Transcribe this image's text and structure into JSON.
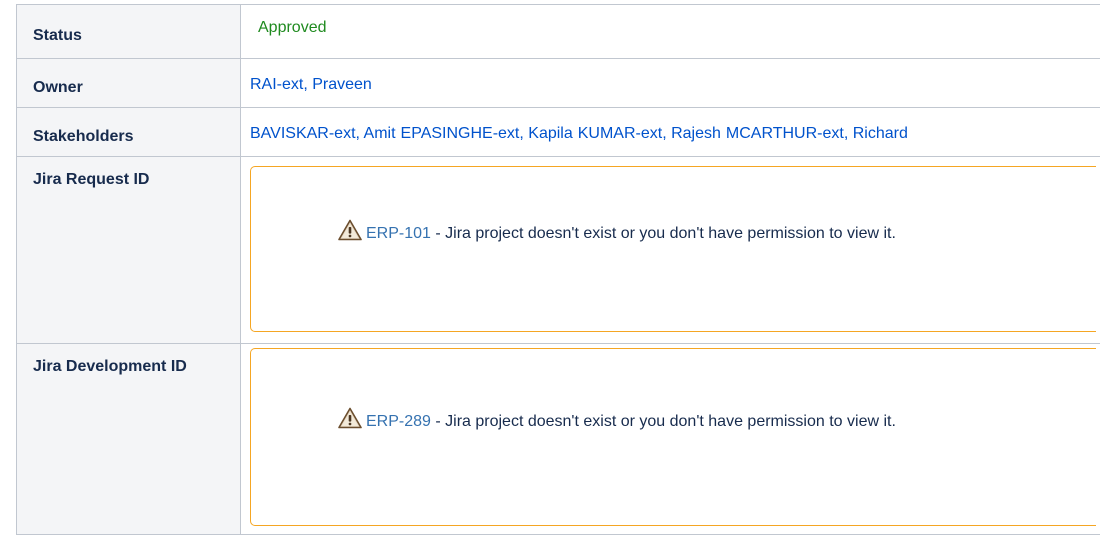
{
  "properties": {
    "status": {
      "label": "Status",
      "value": "Approved",
      "color": "#1f8a1f"
    },
    "owner": {
      "label": "Owner",
      "value": "RAI-ext, Praveen"
    },
    "stakeholders": {
      "label": "Stakeholders",
      "users": [
        "BAVISKAR-ext, Amit",
        "EPASINGHE-ext, Kapila",
        "KUMAR-ext, Rajesh",
        "MCARTHUR-ext, Richard"
      ]
    },
    "jira_request": {
      "label": "Jira Request ID",
      "issue_key": "ERP-101",
      "message": " - Jira project doesn't exist or you don't have permission to view it.",
      "icon": "warning-icon"
    },
    "jira_development": {
      "label": "Jira Development ID",
      "issue_key": "ERP-289",
      "message": " - Jira project doesn't exist or you don't have permission to view it.",
      "icon": "warning-icon"
    }
  },
  "colors": {
    "link": "#0052cc",
    "warning_border": "#f5a623",
    "header_bg": "#f4f5f7"
  }
}
